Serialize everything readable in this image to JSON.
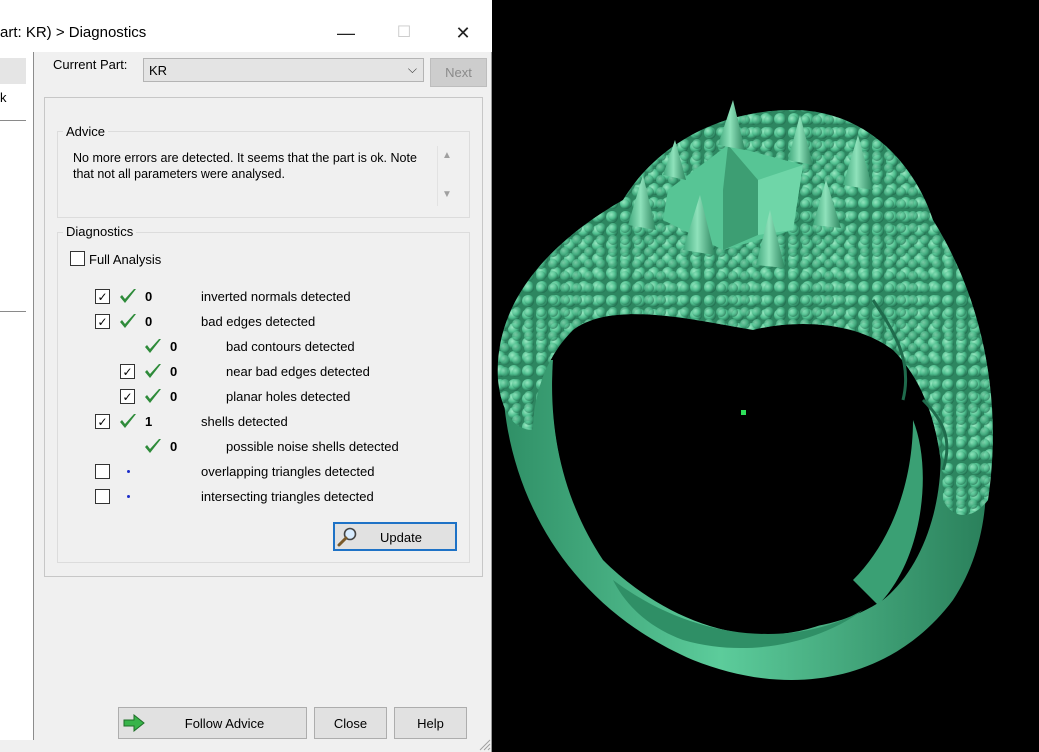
{
  "window": {
    "title": "art: KR) > Diagnostics",
    "minimize_glyph": "—",
    "maximize_glyph": "☐",
    "close_glyph": "✕"
  },
  "side_panel": {
    "item_text": "k"
  },
  "part": {
    "label": "Current Part:",
    "selected": "KR",
    "next_label": "Next"
  },
  "advice": {
    "title": "Advice",
    "text": "No more errors are detected. It seems that the part is ok. Note that not all parameters were analysed."
  },
  "diagnostics": {
    "title": "Diagnostics",
    "full_analysis_label": "Full Analysis",
    "full_analysis_checked": false,
    "rows": [
      {
        "label": "inverted normals detected",
        "count": "0",
        "status": "ok",
        "checkbox": true,
        "checked": true,
        "indent": 0
      },
      {
        "label": "bad edges detected",
        "count": "0",
        "status": "ok",
        "checkbox": true,
        "checked": true,
        "indent": 0
      },
      {
        "label": "bad contours detected",
        "count": "0",
        "status": "ok",
        "checkbox": false,
        "checked": false,
        "indent": 1
      },
      {
        "label": "near bad edges detected",
        "count": "0",
        "status": "ok",
        "checkbox": true,
        "checked": true,
        "indent": 1
      },
      {
        "label": "planar holes detected",
        "count": "0",
        "status": "ok",
        "checkbox": true,
        "checked": true,
        "indent": 1
      },
      {
        "label": "shells detected",
        "count": "1",
        "status": "ok",
        "checkbox": true,
        "checked": true,
        "indent": 0
      },
      {
        "label": "possible noise shells detected",
        "count": "0",
        "status": "ok",
        "checkbox": false,
        "checked": false,
        "indent": 1
      },
      {
        "label": "overlapping triangles detected",
        "count": "",
        "status": "not-analysed",
        "checkbox": true,
        "checked": false,
        "indent": 0
      },
      {
        "label": "intersecting triangles detected",
        "count": "",
        "status": "not-analysed",
        "checkbox": true,
        "checked": false,
        "indent": 0
      }
    ],
    "update_label": "Update",
    "update_icon": "magnifier-icon"
  },
  "buttons": {
    "follow_advice": "Follow Advice",
    "follow_icon": "green-arrow-icon",
    "close": "Close",
    "help": "Help"
  },
  "colors": {
    "tick_green": "#2e8b3a",
    "dot_blue": "#1a2bc9",
    "model_green": "#4fbf8f",
    "focus_blue": "#1e72c6"
  }
}
